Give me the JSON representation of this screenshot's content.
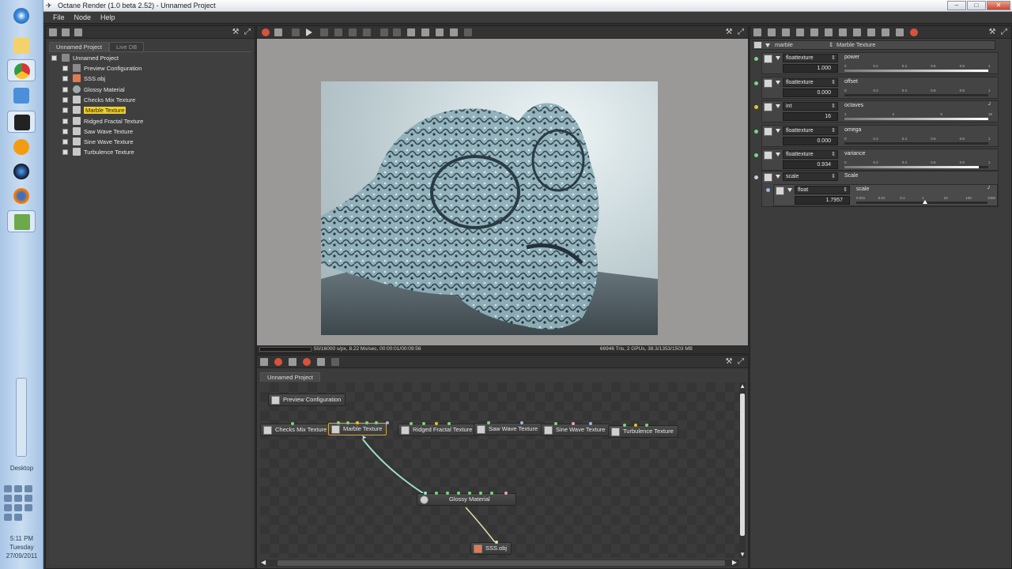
{
  "window": {
    "title": "Octane Render (1.0 beta 2.52) - Unnamed Project",
    "controls": [
      "–",
      "□",
      "✕"
    ]
  },
  "menu": [
    "File",
    "Node",
    "Help"
  ],
  "taskbar": {
    "desktop_label": "Desktop",
    "clock_time": "5:11 PM",
    "clock_day": "Tuesday",
    "clock_date": "27/09/2011"
  },
  "outliner": {
    "tabs": [
      "Unnamed Project",
      "Live DB"
    ],
    "root": "Unnamed Project",
    "items": [
      {
        "label": "Preview Configuration",
        "icon": "preview-config-icon",
        "selected": false
      },
      {
        "label": "SSS.obj",
        "icon": "mesh-icon",
        "selected": false
      },
      {
        "label": "Glossy Material",
        "icon": "material-sphere-icon",
        "selected": false
      },
      {
        "label": "Checks Mix Texture",
        "icon": "texture-icon",
        "selected": false
      },
      {
        "label": "Marble Texture",
        "icon": "texture-icon",
        "selected": true
      },
      {
        "label": "Ridged Fractal Texture",
        "icon": "texture-icon",
        "selected": false
      },
      {
        "label": "Saw Wave Texture",
        "icon": "texture-icon",
        "selected": false
      },
      {
        "label": "Sine Wave Texture",
        "icon": "texture-icon",
        "selected": false
      },
      {
        "label": "Turbulence Texture",
        "icon": "texture-icon",
        "selected": false
      }
    ]
  },
  "viewport": {
    "status_left": "50/16000 s/px, 8.22 Ms/sec, 00:00:01/00:09:56",
    "status_right": "66946 Tris, 2 GPUs, 38.3/1353/1503 MB"
  },
  "nodegraph": {
    "tab": "Unnamed Project",
    "nodes": {
      "preview": "Preview Configuration",
      "checks": "Checks Mix Texture",
      "marble": "Marble Texture",
      "ridged": "Ridged Fractal Texture",
      "saw": "Saw Wave Texture",
      "sine": "Sine Wave Texture",
      "turb": "Turbulence Texture",
      "glossy": "Glossy Material",
      "sss": "SSS.obj"
    }
  },
  "params": {
    "node_name": "marble",
    "node_type": "Marble Texture",
    "rows": [
      {
        "type": "floattexture",
        "name": "power",
        "value": "1.000",
        "fraction": 1.0,
        "ticks": [
          "0",
          "0.2",
          "0.4",
          "0.6",
          "0.8",
          "1"
        ]
      },
      {
        "type": "floattexture",
        "name": "offset",
        "value": "0.000",
        "fraction": 0.0,
        "ticks": [
          "0",
          "0.2",
          "0.4",
          "0.6",
          "0.8",
          "1"
        ]
      },
      {
        "type": "int",
        "name": "octaves",
        "value": "16",
        "fraction": 1.0,
        "ticks": [
          "1",
          "2",
          "5",
          "16"
        ]
      },
      {
        "type": "floattexture",
        "name": "omega",
        "value": "0.000",
        "fraction": 0.0,
        "ticks": [
          "0",
          "0.2",
          "0.4",
          "0.6",
          "0.8",
          "1"
        ]
      },
      {
        "type": "floattexture",
        "name": "variance",
        "value": "0.934",
        "fraction": 0.934,
        "ticks": [
          "0",
          "0.2",
          "0.4",
          "0.6",
          "0.8",
          "1"
        ]
      }
    ],
    "scale": {
      "type": "scale",
      "label": "Scale",
      "sub_type": "float",
      "sub_name": "scale",
      "value": "1.7957",
      "ticks": [
        "0.001",
        "0.01",
        "0.1",
        "1",
        "10",
        "100",
        "1000"
      ]
    },
    "colors": {
      "float_pin": "#7ad67a",
      "int_pin": "#e8c41e",
      "selection": "#f2cf1f"
    }
  }
}
